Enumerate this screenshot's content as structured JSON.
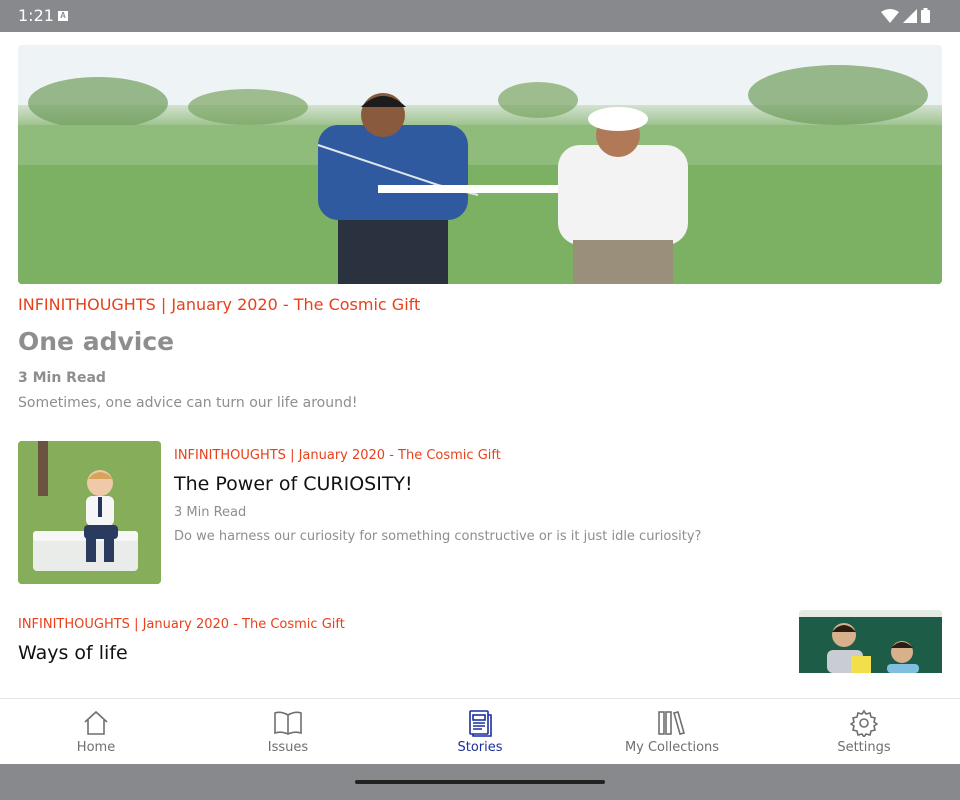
{
  "status_bar": {
    "time": "1:21",
    "badge": "A"
  },
  "featured": {
    "category": "INFINITHOUGHTS | January 2020 - The Cosmic Gift",
    "title": "One advice",
    "read_time": "3 Min Read",
    "subtitle": "Sometimes, one advice can turn our life around!"
  },
  "stories": [
    {
      "category": "INFINITHOUGHTS | January 2020 - The Cosmic Gift",
      "title": "The Power of CURIOSITY!",
      "read_time": "3 Min Read",
      "subtitle": "Do we harness our curiosity for something constructive or is it just idle curiosity?"
    },
    {
      "category": "INFINITHOUGHTS | January 2020 - The Cosmic Gift",
      "title": "Ways of life"
    }
  ],
  "nav": {
    "items": [
      {
        "label": "Home",
        "icon": "home-icon"
      },
      {
        "label": "Issues",
        "icon": "book-icon"
      },
      {
        "label": "Stories",
        "icon": "stories-icon"
      },
      {
        "label": "My Collections",
        "icon": "collections-icon"
      },
      {
        "label": "Settings",
        "icon": "gear-icon"
      }
    ],
    "active": "Stories"
  },
  "colors": {
    "accent": "#e8401b",
    "nav_active": "#1a2fa0",
    "muted": "#8e8e8e",
    "system_bar": "#88898c"
  }
}
